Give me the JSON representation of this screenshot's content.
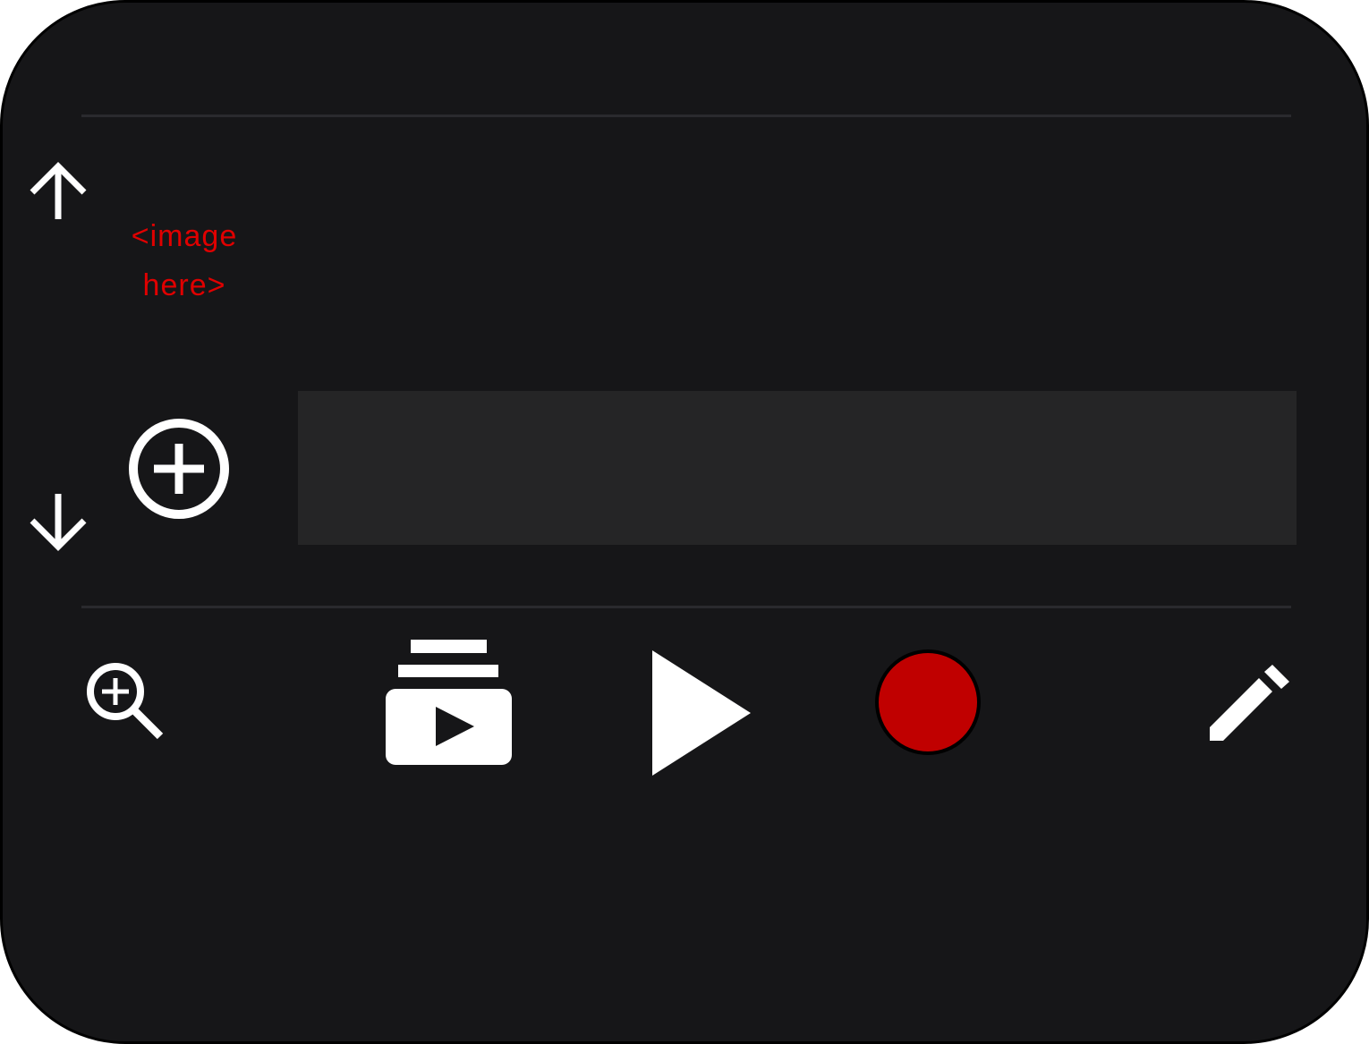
{
  "preview": {
    "placeholder_line1": "<image",
    "placeholder_line2": "here>"
  },
  "icons": {
    "move_up": "arrow-up-icon",
    "move_down": "arrow-down-icon",
    "add": "add-circle-icon",
    "zoom": "zoom-in-icon",
    "playlist": "video-playlist-icon",
    "play": "play-icon",
    "record": "record-icon",
    "edit": "pencil-icon"
  },
  "colors": {
    "panel_background": "#161618",
    "track_background": "#252526",
    "divider": "#2a2a2e",
    "icon": "#ffffff",
    "record": "#c00000",
    "placeholder_text": "#e00000"
  }
}
